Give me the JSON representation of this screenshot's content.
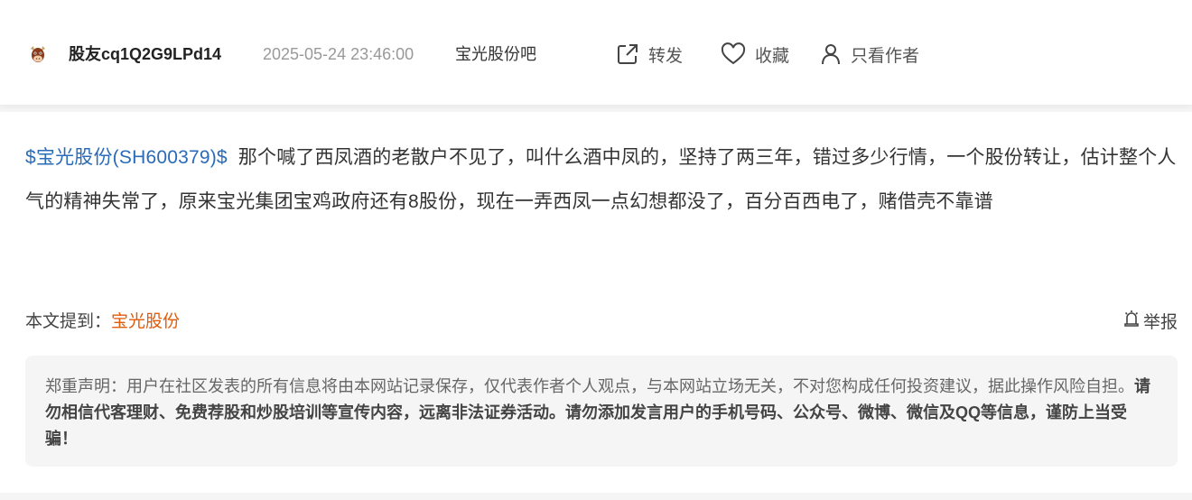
{
  "header": {
    "username": "股友cq1Q2G9LPd14",
    "time": "2025-05-24 23:46:00",
    "bar_name": "宝光股份吧",
    "actions": {
      "share": "转发",
      "favorite": "收藏",
      "only_author": "只看作者"
    },
    "icons": {
      "avatar": "cow-avatar-icon",
      "share": "share-icon",
      "favorite": "heart-icon",
      "only_author": "user-icon",
      "report": "report-icon"
    }
  },
  "post": {
    "stock_link": "$宝光股份(SH600379)$",
    "body": "那个喊了西凤酒的老散户不见了，叫什么酒中凤的，坚持了两三年，错过多少行情，一个股份转让，估计整个人气的精神失常了，原来宝光集团宝鸡政府还有8股份，现在一弄西凤一点幻想都没了，百分百西电了，赌借壳不靠谱"
  },
  "mention": {
    "label": "本文提到：",
    "stock": "宝光股份"
  },
  "report": {
    "label": "举报"
  },
  "disclaimer": {
    "normal": "郑重声明：用户在社区发表的所有信息将由本网站记录保存，仅代表作者个人观点，与本网站立场无关，不对您构成任何投资建议，据此操作风险自担。",
    "bold": "请勿相信代客理财、免费荐股和炒股培训等宣传内容，远离非法证券活动。请勿添加发言用户的手机号码、公众号、微博、微信及QQ等信息，谨防上当受骗！"
  },
  "colors": {
    "link_blue": "#2a6bb8",
    "link_orange": "#e05b0a",
    "muted": "#999999"
  }
}
